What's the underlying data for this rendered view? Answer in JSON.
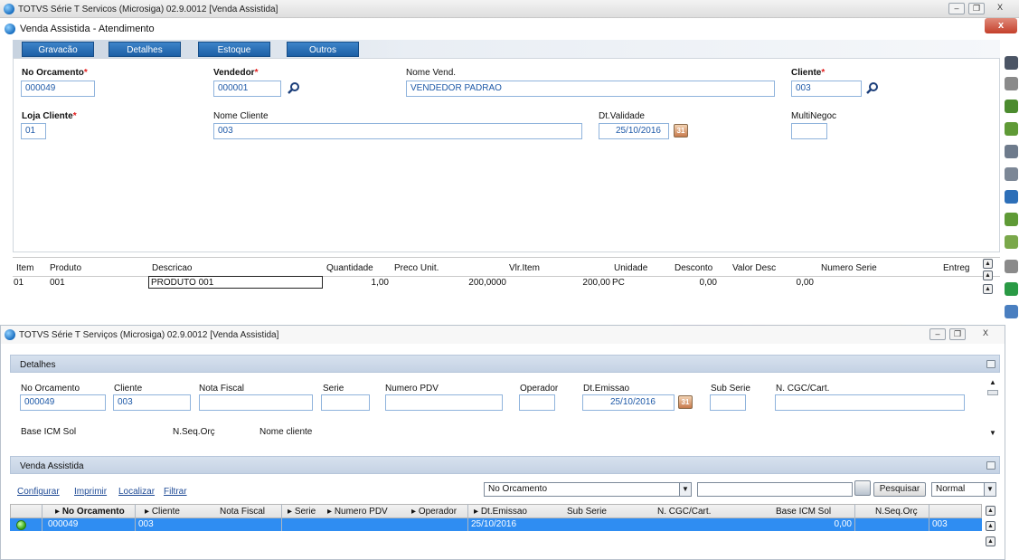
{
  "top_window": {
    "app_title": "TOTVS Série T Servicos (Microsiga) 02.9.0012 [Venda Assistida]",
    "dialog_title": "Venda Assistida - Atendimento",
    "close_label": "x",
    "minimize_label": "–",
    "maximize_label": "❐",
    "close_win_label": "X",
    "toolbar": [
      "Gravacão",
      "Detalhes",
      "Estoque",
      "Outros"
    ],
    "fields": {
      "no_orcamento": {
        "label": "No Orcamento",
        "value": "000049"
      },
      "vendedor": {
        "label": "Vendedor",
        "value": "000001"
      },
      "nome_vend": {
        "label": "Nome Vend.",
        "value": "VENDEDOR PADRAO"
      },
      "cliente": {
        "label": "Cliente",
        "value": "003"
      },
      "loja_cliente": {
        "label": "Loja Cliente",
        "value": "01"
      },
      "nome_cliente": {
        "label": "Nome Cliente",
        "value": "003"
      },
      "dt_validade": {
        "label": "Dt.Validade",
        "value": "25/10/2016"
      },
      "multinegoc": {
        "label": "MultiNegoc",
        "value": ""
      }
    },
    "items_grid": {
      "headers": [
        "Item",
        "Produto",
        "Descricao",
        "Quantidade",
        "Preco Unit.",
        "Vlr.Item",
        "Unidade",
        "Desconto",
        "Valor Desc",
        "Numero Serie",
        "Entreg"
      ],
      "rows": [
        {
          "item": "01",
          "produto": "001",
          "descricao": "PRODUTO 001",
          "quantidade": "1,00",
          "preco_unit": "200,0000",
          "vlr_item": "200,00",
          "unidade": "PC",
          "desconto": "0,00",
          "valor_desc": "0,00"
        }
      ]
    }
  },
  "bottom_window": {
    "title": "TOTVS Série T Serviços (Microsiga) 02.9.0012 [Venda Assistida]",
    "detalhes": {
      "title": "Detalhes",
      "fields": {
        "no_orcamento": {
          "label": "No Orcamento",
          "value": "000049"
        },
        "cliente": {
          "label": "Cliente",
          "value": "003"
        },
        "nota_fiscal": {
          "label": "Nota Fiscal",
          "value": ""
        },
        "serie": {
          "label": "Serie",
          "value": ""
        },
        "numero_pdv": {
          "label": "Numero PDV",
          "value": ""
        },
        "operador": {
          "label": "Operador",
          "value": ""
        },
        "dt_emissao": {
          "label": "Dt.Emissao",
          "value": "25/10/2016"
        },
        "sub_serie": {
          "label": "Sub Serie",
          "value": ""
        },
        "cgc_cart": {
          "label": "N. CGC/Cart.",
          "value": ""
        }
      },
      "more_labels": [
        "Base ICM Sol",
        "N.Seq.Orç",
        "Nome cliente"
      ]
    },
    "venda": {
      "title": "Venda Assistida",
      "links": [
        "Configurar",
        "Imprimir",
        "Localizar",
        "Filtrar"
      ],
      "search_field": "No Orcamento",
      "search_button": "Pesquisar",
      "mode": "Normal",
      "grid": {
        "headers": [
          "No Orcamento",
          "Cliente",
          "Nota Fiscal",
          "Serie",
          "Numero PDV",
          "Operador",
          "Dt.Emissao",
          "Sub Serie",
          "N. CGC/Cart.",
          "Base ICM Sol",
          "N.Seq.Orç"
        ],
        "row": {
          "no_orcamento": "000049",
          "cliente": "003",
          "dt_emissao": "25/10/2016",
          "base_icm_sol": "0,00",
          "extra": "003"
        }
      }
    }
  }
}
